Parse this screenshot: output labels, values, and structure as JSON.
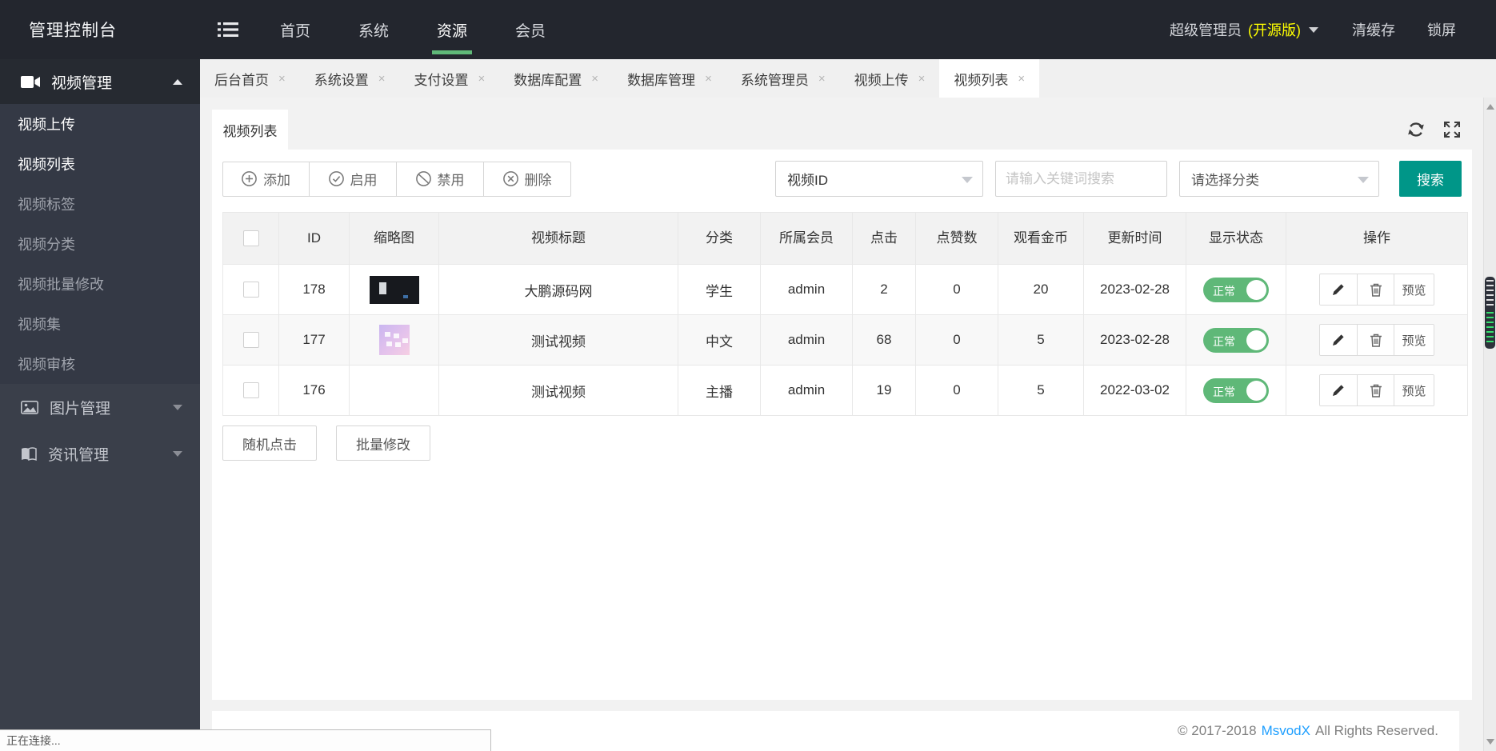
{
  "colors": {
    "accent": "#009688",
    "toggle_green": "#5FB878",
    "badge_yellow": "#ffff00",
    "link_blue": "#1E9FFF",
    "header_bg": "#23262e",
    "sidebar_bg": "#3a3f4a"
  },
  "header": {
    "brand": "管理控制台",
    "nav": [
      {
        "label": "首页"
      },
      {
        "label": "系统"
      },
      {
        "label": "资源"
      },
      {
        "label": "会员"
      }
    ],
    "user": {
      "name": "超级管理员",
      "badge": "(开源版)"
    },
    "actions": [
      {
        "label": "清缓存"
      },
      {
        "label": "锁屏"
      }
    ]
  },
  "sidebar": {
    "groups": [
      {
        "label": "视频管理"
      },
      {
        "label": "图片管理"
      },
      {
        "label": "资讯管理"
      }
    ],
    "video_items": [
      {
        "label": "视频上传"
      },
      {
        "label": "视频列表"
      },
      {
        "label": "视频标签"
      },
      {
        "label": "视频分类"
      },
      {
        "label": "视频批量修改"
      },
      {
        "label": "视频集"
      },
      {
        "label": "视频审核"
      }
    ]
  },
  "tabs": [
    {
      "label": "后台首页"
    },
    {
      "label": "系统设置"
    },
    {
      "label": "支付设置"
    },
    {
      "label": "数据库配置"
    },
    {
      "label": "数据库管理"
    },
    {
      "label": "系统管理员"
    },
    {
      "label": "视频上传"
    },
    {
      "label": "视频列表"
    }
  ],
  "panel": {
    "tab_label": "视频列表"
  },
  "toolbar": {
    "add_label": "添加",
    "enable_label": "启用",
    "disable_label": "禁用",
    "delete_label": "删除",
    "filter_field_value": "视频ID",
    "search_placeholder": "请输入关键词搜索",
    "category_placeholder": "请选择分类",
    "search_label": "搜索"
  },
  "table": {
    "columns": [
      "ID",
      "缩略图",
      "视频标题",
      "分类",
      "所属会员",
      "点击",
      "点赞数",
      "观看金币",
      "更新时间",
      "显示状态",
      "操作"
    ],
    "preview_label": "预览",
    "rows": [
      {
        "id": "178",
        "title": "大鹏源码网",
        "category": "学生",
        "member": "admin",
        "clicks": "2",
        "likes": "0",
        "coins": "20",
        "updated": "2023-02-28",
        "status": "正常"
      },
      {
        "id": "177",
        "title": "测试视频",
        "category": "中文",
        "member": "admin",
        "clicks": "68",
        "likes": "0",
        "coins": "5",
        "updated": "2023-02-28",
        "status": "正常"
      },
      {
        "id": "176",
        "title": "测试视频",
        "category": "主播",
        "member": "admin",
        "clicks": "19",
        "likes": "0",
        "coins": "5",
        "updated": "2022-03-02",
        "status": "正常"
      }
    ]
  },
  "bottom_buttons": [
    {
      "label": "随机点击"
    },
    {
      "label": "批量修改"
    }
  ],
  "footer": {
    "prefix": "© 2017-2018",
    "brand": "MsvodX",
    "suffix": "All Rights Reserved."
  },
  "status_bar": {
    "text": "正在连接..."
  }
}
